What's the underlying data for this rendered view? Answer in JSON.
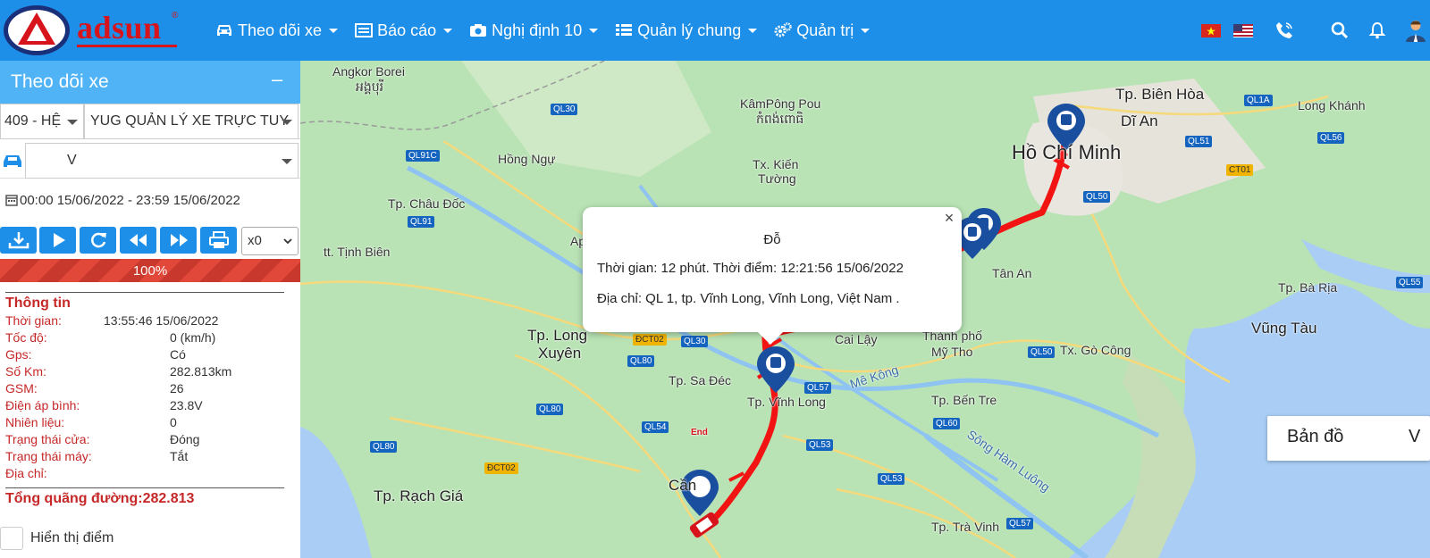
{
  "header": {
    "logo_text": "adsun",
    "logo_reg": "®",
    "nav": [
      {
        "label": "Theo dõi xe",
        "icon": "car-icon"
      },
      {
        "label": "Báo cáo",
        "icon": "report-icon"
      },
      {
        "label": "Nghị định 10",
        "icon": "camera-icon"
      },
      {
        "label": "Quản lý chung",
        "icon": "list-icon"
      },
      {
        "label": "Quản trị",
        "icon": "gears-icon"
      }
    ],
    "right_icons": [
      "vietnam-flag-icon",
      "us-flag-icon",
      "phone-icon",
      "search-icon",
      "bell-icon",
      "user-avatar-icon"
    ]
  },
  "panel": {
    "title": "Theo dõi xe",
    "company_select": "409 - HỆ",
    "company_name": "YUG QUẢN LÝ XE TRỰC TUY",
    "vehicle_select": "V",
    "date_range": "00:00 15/06/2022 - 23:59 15/06/2022",
    "speed_select": "x0",
    "progress_label": "100%",
    "progress_value": 1.0,
    "info": {
      "title": "Thông tin",
      "rows": [
        {
          "label": "Thời gian:",
          "value": "13:55:46 15/06/2022"
        },
        {
          "label": "Tốc độ:",
          "value": "0 (km/h)"
        },
        {
          "label": "Gps:",
          "value": "Có"
        },
        {
          "label": "Số Km:",
          "value": "282.813km"
        },
        {
          "label": "GSM:",
          "value": "26"
        },
        {
          "label": "Điện áp bình:",
          "value": "23.8V"
        },
        {
          "label": "Nhiên liệu:",
          "value": "0"
        },
        {
          "label": "Trạng thái cửa:",
          "value": "Đóng"
        },
        {
          "label": "Trạng thái máy:",
          "value": "Tắt"
        },
        {
          "label": "Địa chỉ:",
          "value": ""
        }
      ],
      "total": "Tổng quãng đường:282.813"
    },
    "show_points_label": "Hiển thị điểm"
  },
  "popup": {
    "title": "Đỗ",
    "time_line": "Thời gian: 12 phút. Thời điểm: 12:21:56 15/06/2022",
    "address_line": "Địa chỉ: QL 1, tp. Vĩnh Long, Vĩnh Long, Việt Nam ."
  },
  "map": {
    "type_button": "Bản đồ",
    "type_button_2": "V",
    "places": [
      "Angkor Borei",
      "អង្គបុរី",
      "KâmPông Pou",
      "កំពង់ពោធិ",
      "Hồ Chí Minh",
      "Tp. Biên Hòa",
      "Dĩ An",
      "Long Khánh",
      "Hồng Ngự",
      "Tx. Kiến",
      "Tường",
      "Tp. Châu Đốc",
      "tt. Tịnh Biên",
      "Ap",
      "Tân An",
      "Tp. Bà Rịa",
      "Vũng Tàu",
      "Tp. Long",
      "Xuyên",
      "Cai Lậy",
      "Thành phố",
      "Mỹ Tho",
      "Tx. Gò Công",
      "Tp. Sa Đéc",
      "Tp. Vĩnh Long",
      "Mê Kông",
      "Tp. Bến Tre",
      "Sông Hàm Luông",
      "Tp. Rạch Giá",
      "Cần",
      "Tp. Trà Vinh"
    ],
    "roads": [
      "QL30",
      "QL91C",
      "QL91",
      "QL1A",
      "QL51",
      "QL56",
      "CT01",
      "QL50",
      "QL55",
      "ĐCT02",
      "QL30",
      "QL80",
      "QL57",
      "QL60",
      "QL50",
      "QL80",
      "QL54",
      "QL53",
      "QL80",
      "ĐCT02",
      "QL53",
      "QL57"
    ],
    "end_label": "End",
    "colors": {
      "route": "#f21313",
      "marker": "#1a4fa0",
      "water": "#a9cdf5",
      "land": "#b9e3b5"
    }
  }
}
